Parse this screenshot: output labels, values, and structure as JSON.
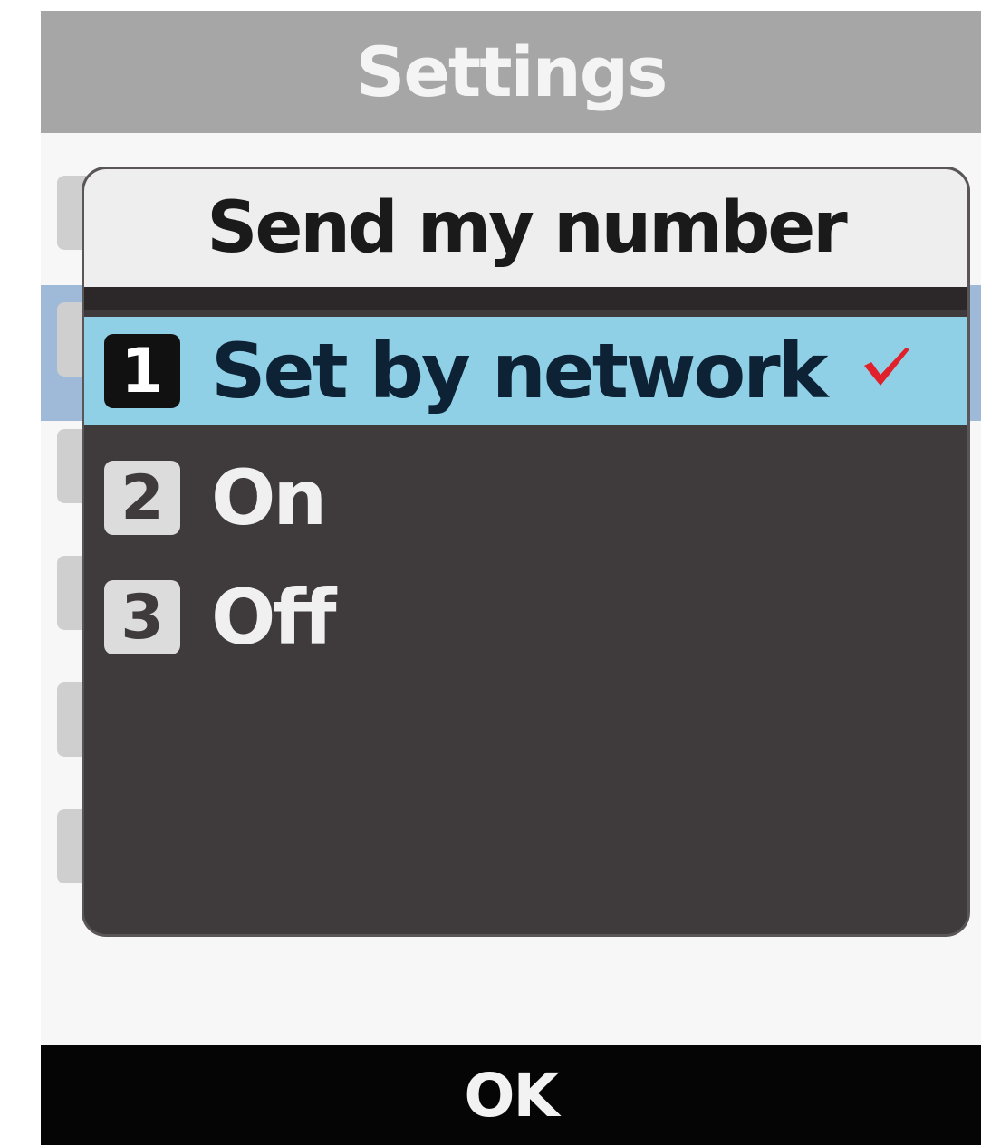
{
  "window": {
    "title": "Settings"
  },
  "dialog": {
    "title": "Send my number",
    "options": [
      {
        "number": "1",
        "label": "Set by network",
        "selected": true,
        "checked": true
      },
      {
        "number": "2",
        "label": "On",
        "selected": false,
        "checked": false
      },
      {
        "number": "3",
        "label": "Off",
        "selected": false,
        "checked": false
      }
    ],
    "check_icon": "check-mark-icon"
  },
  "softkeys": {
    "center_label": "OK"
  },
  "colors": {
    "title_bar": "#a6a6a6",
    "dialog_background": "#3f3a3b",
    "selection_highlight": "#8fd0e6",
    "check_mark": "#e0202a"
  }
}
